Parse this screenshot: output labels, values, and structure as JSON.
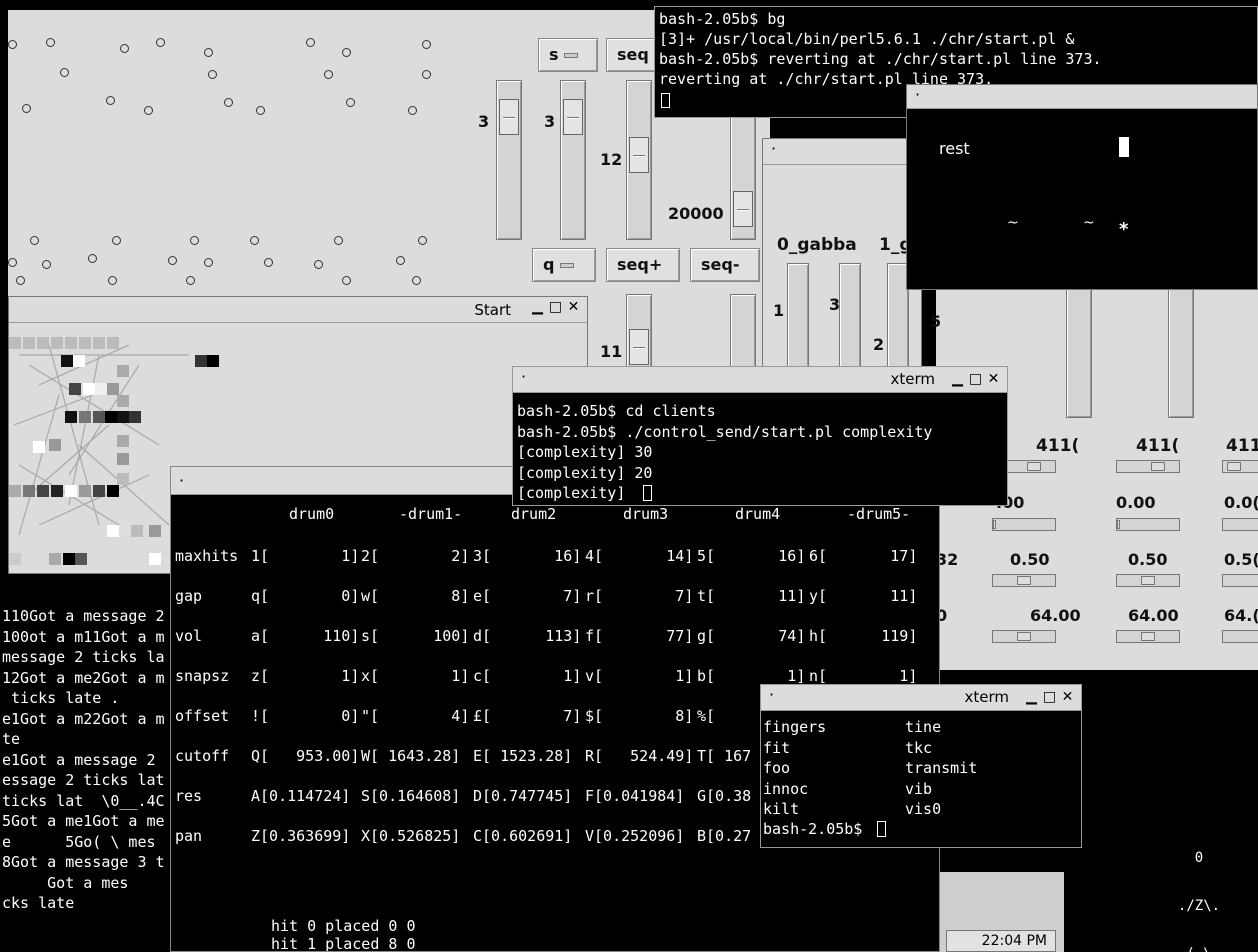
{
  "dots_panel": {
    "seq_buttons": [
      {
        "menu": "s",
        "label": "seq"
      },
      {
        "menu": "q",
        "label": "seq+",
        "label2": "seq-"
      }
    ],
    "slider_values": [
      "3",
      "3",
      "12",
      "20000",
      "11"
    ]
  },
  "terminal_top": {
    "lines": [
      "bash-2.05b$ bg",
      "[3]+ /usr/local/bin/perl5.6.1 ./chr/start.pl &",
      "bash-2.05b$ reverting at ./chr/start.pl line 373.",
      "reverting at ./chr/start.pl line 373."
    ]
  },
  "rest_window": {
    "label": "rest",
    "marks": [
      "~",
      "~",
      "*"
    ]
  },
  "gabba_window": {
    "headers": [
      "0_gabba",
      "1_g"
    ],
    "slider_values": [
      "1",
      "3",
      "2",
      "5"
    ]
  },
  "start_window": {
    "title": "Start"
  },
  "xterm_complexity": {
    "title": "xterm",
    "lines": [
      "bash-2.05b$ cd clients",
      "bash-2.05b$ ./control_send/start.pl complexity",
      "[complexity] 30",
      "[complexity] 20",
      "[complexity] "
    ]
  },
  "drum_table": {
    "headers": [
      "drum0",
      "-drum1-",
      "drum2",
      "drum3",
      "drum4",
      "-drum5-"
    ],
    "rows": [
      {
        "label": "maxhits",
        "cells": [
          "1[        1]",
          "2[        2]",
          "3[       16]",
          "4[       14]",
          "5[       16]",
          "6[       17]"
        ]
      },
      {
        "label": "gap",
        "cells": [
          "q[        0]",
          "w[        8]",
          "e[        7]",
          "r[        7]",
          "t[       11]",
          "y[       11]"
        ]
      },
      {
        "label": "vol",
        "cells": [
          "a[      110]",
          "s[      100]",
          "d[      113]",
          "f[       77]",
          "g[       74]",
          "h[      119]"
        ]
      },
      {
        "label": "snapsz",
        "cells": [
          "z[        1]",
          "x[        1]",
          "c[        1]",
          "v[        1]",
          "b[        1]",
          "n[        1]"
        ]
      },
      {
        "label": "offset",
        "cells": [
          "![        0]",
          "\"[        4]",
          "£[        7]",
          "$[        8]",
          "%[",
          ""
        ]
      },
      {
        "label": "cutoff",
        "cells": [
          "Q[   953.00]",
          "W[ 1643.28]",
          "E[ 1523.28]",
          "R[   524.49]",
          "T[ 167",
          ""
        ]
      },
      {
        "label": "res",
        "cells": [
          "A[0.114724]",
          "S[0.164608]",
          "D[0.747745]",
          "F[0.041984]",
          "G[0.38",
          ""
        ]
      },
      {
        "label": "pan",
        "cells": [
          "Z[0.363699]",
          "X[0.526825]",
          "C[0.602691]",
          "V[0.252096]",
          "B[0.27",
          ""
        ]
      }
    ],
    "footer": [
      "hit 0 placed 0 0",
      "hit 1 placed 8 0"
    ]
  },
  "left_log": {
    "lines": [
      "110Got a message 2",
      "100ot a m11Got a m",
      "message 2 ticks la",
      "12Got a me2Got a m",
      " ticks late .",
      "e1Got a m22Got a m",
      "te",
      "e1Got a message 2",
      "",
      "essage 2 ticks lat",
      "",
      "ticks lat  \\0__.4C",
      "5Got a me1Got a me",
      "e      5Go( \\ mes",
      "8Got a message 3 t",
      "     Got a mes",
      "cks late"
    ]
  },
  "mixer": {
    "top_values": [
      "411(",
      "411(",
      "411"
    ],
    "row1": [
      ".00",
      "0.00",
      "0.0("
    ],
    "row2": [
      "32",
      "0.50",
      "0.50",
      "0.5("
    ],
    "row3": [
      "0",
      "64.00",
      "64.00",
      "64.("
    ]
  },
  "xterm_ls": {
    "title": "xterm",
    "col1": [
      "fingers",
      "fit",
      "foo",
      "innoc",
      "kilt"
    ],
    "col2": [
      "tine",
      "tkc",
      "transmit",
      "vib",
      "vis0"
    ],
    "prompt": "bash-2.05b$ "
  },
  "stick_figure": [
    "0",
    "./Z\\.",
    "( \\"
  ],
  "clock": "22:04 PM",
  "colors": {
    "terminal_bg": "#000000",
    "terminal_fg": "#ffffff",
    "panel_bg": "#dcdcdc"
  }
}
